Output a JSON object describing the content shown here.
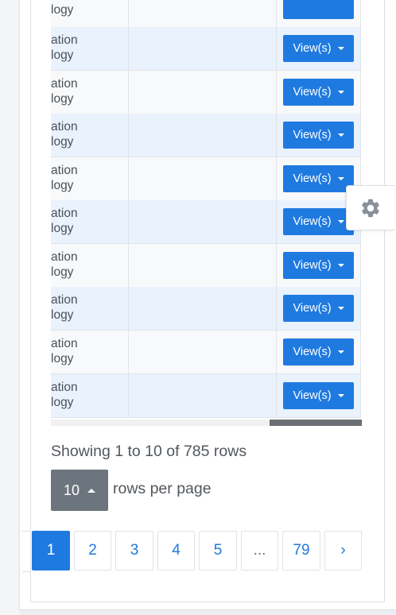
{
  "table": {
    "top_row_text_line2": "logy",
    "rows": [
      {
        "text_line1": "ation",
        "text_line2": "logy",
        "view_label": "View(s)"
      },
      {
        "text_line1": "ation",
        "text_line2": "logy",
        "view_label": "View(s)"
      },
      {
        "text_line1": "ation",
        "text_line2": "logy",
        "view_label": "View(s)"
      },
      {
        "text_line1": "ation",
        "text_line2": "logy",
        "view_label": "View(s)"
      },
      {
        "text_line1": "ation",
        "text_line2": "logy",
        "view_label": "View(s)"
      },
      {
        "text_line1": "ation",
        "text_line2": "logy",
        "view_label": "View(s)"
      },
      {
        "text_line1": "ation",
        "text_line2": "logy",
        "view_label": "View(s)"
      },
      {
        "text_line1": "ation",
        "text_line2": "logy",
        "view_label": "View(s)"
      },
      {
        "text_line1": "ation",
        "text_line2": "logy",
        "view_label": "View(s)"
      }
    ]
  },
  "pagination": {
    "showing_text": "Showing 1 to 10 of 785 rows",
    "page_size": "10",
    "rows_per_page_label": "rows per page",
    "pages": [
      {
        "label": "1",
        "active": true
      },
      {
        "label": "2",
        "active": false
      },
      {
        "label": "3",
        "active": false
      },
      {
        "label": "4",
        "active": false
      },
      {
        "label": "5",
        "active": false
      },
      {
        "label": "...",
        "active": false
      },
      {
        "label": "79",
        "active": false
      },
      {
        "label": "›",
        "active": false
      }
    ]
  },
  "colors": {
    "primary": "#1f7ae0",
    "secondary_button": "#6c757d",
    "row_highlight": "#e9f2fd",
    "text": "#52575d"
  },
  "icons": {
    "settings": "gear-icon",
    "dropdown": "caret-down-icon",
    "pagesize_toggle": "caret-up-icon"
  }
}
